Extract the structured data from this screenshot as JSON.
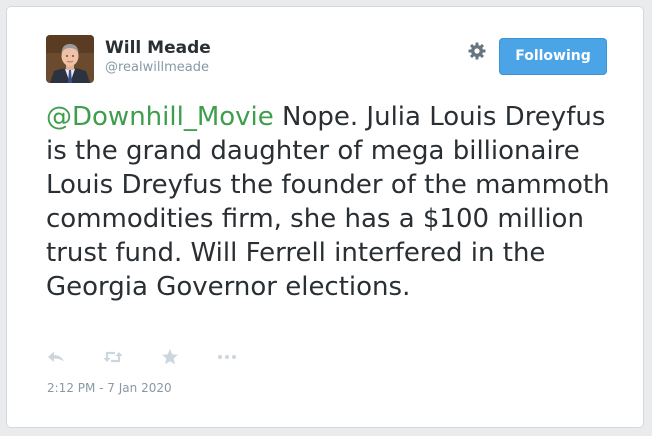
{
  "user": {
    "display_name": "Will Meade",
    "handle": "@realwillmeade"
  },
  "follow_button": {
    "label": "Following",
    "color": "#4aa4e6"
  },
  "settings": {
    "icon": "gear-icon"
  },
  "tweet": {
    "mention": "@Downhill_Movie",
    "text": " Nope. Julia Louis Dreyfus is the grand daughter of mega billionaire Louis Dreyfus the founder of the mammoth commodities firm, she has a $100 million trust fund. Will Ferrell interfered in the Georgia Governor elections.",
    "mention_color": "#3f9e4d"
  },
  "actions": {
    "reply_icon": "reply-icon",
    "retweet_icon": "retweet-icon",
    "favorite_icon": "star-icon",
    "more_icon": "more-icon"
  },
  "timestamp": "2:12 PM - 7 Jan 2020"
}
